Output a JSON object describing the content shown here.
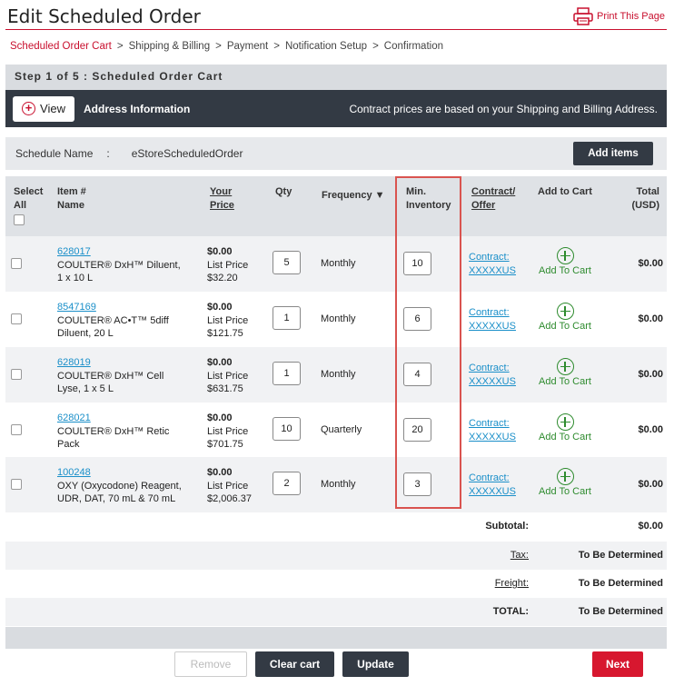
{
  "page": {
    "title": "Edit Scheduled Order",
    "print_label": "Print This Page"
  },
  "breadcrumb": [
    "Scheduled Order Cart",
    "Shipping & Billing",
    "Payment",
    "Notification Setup",
    "Confirmation"
  ],
  "step": {
    "label": "Step 1 of 5 : Scheduled Order Cart"
  },
  "address": {
    "view_label": "View",
    "title": "Address Information",
    "note": "Contract prices are based on your Shipping and Billing Address."
  },
  "schedule": {
    "label": "Schedule Name",
    "colon": ":",
    "value": "eStoreScheduledOrder",
    "add_items_label": "Add items"
  },
  "columns": {
    "select_all_1": "Select",
    "select_all_2": "All",
    "item_1": "Item #",
    "item_2": "Name",
    "price_1": "Your",
    "price_2": "Price",
    "qty": "Qty",
    "frequency": "Frequency ▼",
    "min_inv_1": "Min.",
    "min_inv_2": "Inventory",
    "contract_1": "Contract/",
    "contract_2": "Offer",
    "add_to_cart": "Add to Cart",
    "total_1": "Total",
    "total_2": "(USD)"
  },
  "rows": [
    {
      "item_no": "628017",
      "name_1": "COULTER® DxH™ Diluent,",
      "name_2": "1 x 10 L",
      "price": "$0.00",
      "list_label": "List Price",
      "list_price": "$32.20",
      "qty": "5",
      "frequency": "Monthly",
      "min_inventory": "10",
      "contract_1": "Contract:",
      "contract_2": "XXXXXUS",
      "add_to_cart": "Add To Cart",
      "total": "$0.00"
    },
    {
      "item_no": "8547169",
      "name_1": "COULTER® AC•T™ 5diff",
      "name_2": "Diluent, 20 L",
      "price": "$0.00",
      "list_label": "List Price",
      "list_price": "$121.75",
      "qty": "1",
      "frequency": "Monthly",
      "min_inventory": "6",
      "contract_1": "Contract:",
      "contract_2": "XXXXXUS",
      "add_to_cart": "Add To Cart",
      "total": "$0.00"
    },
    {
      "item_no": "628019",
      "name_1": "COULTER® DxH™ Cell",
      "name_2": "Lyse, 1 x 5 L",
      "price": "$0.00",
      "list_label": "List Price",
      "list_price": "$631.75",
      "qty": "1",
      "frequency": "Monthly",
      "min_inventory": "4",
      "contract_1": "Contract:",
      "contract_2": "XXXXXUS",
      "add_to_cart": "Add To Cart",
      "total": "$0.00"
    },
    {
      "item_no": "628021",
      "name_1": "COULTER® DxH™ Retic",
      "name_2": "Pack",
      "price": "$0.00",
      "list_label": "List Price",
      "list_price": "$701.75",
      "qty": "10",
      "frequency": "Quarterly",
      "min_inventory": "20",
      "contract_1": "Contract:",
      "contract_2": "XXXXXUS",
      "add_to_cart": "Add To Cart",
      "total": "$0.00"
    },
    {
      "item_no": "100248",
      "name_1": "OXY (Oxycodone) Reagent,",
      "name_2": "UDR, DAT, 70 mL & 70 mL",
      "price": "$0.00",
      "list_label": "List Price",
      "list_price": "$2,006.37",
      "qty": "2",
      "frequency": "Monthly",
      "min_inventory": "3",
      "contract_1": "Contract:",
      "contract_2": "XXXXXUS",
      "add_to_cart": "Add To Cart",
      "total": "$0.00"
    }
  ],
  "summary": {
    "subtotal_label": "Subtotal:",
    "subtotal_value": "$0.00",
    "tax_label": "Tax:",
    "tax_value": "To Be Determined",
    "freight_label": "Freight:",
    "freight_value": "To Be Determined",
    "total_label": "TOTAL:",
    "total_value": "To Be Determined"
  },
  "actions": {
    "remove": "Remove",
    "clear_cart": "Clear cart",
    "update": "Update",
    "next": "Next"
  },
  "colors": {
    "brand_red": "#c8102e",
    "dark_bar": "#333a44",
    "link_blue": "#1a8fc9",
    "add_green": "#2e8b2e",
    "highlight": "#d9534f"
  }
}
